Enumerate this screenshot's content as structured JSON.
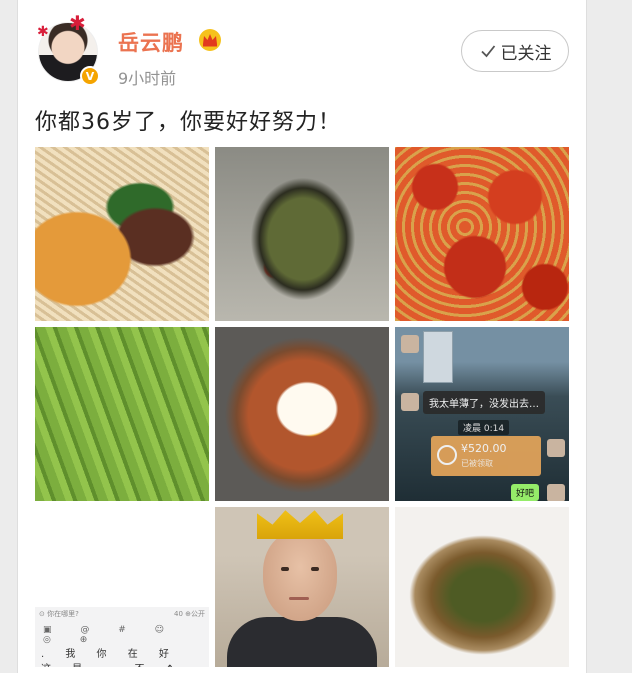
{
  "post": {
    "username": "岳云鹏",
    "timestamp": "9小时前",
    "follow_label": "已关注",
    "text": "你都36岁了，你要好好努力！",
    "verified_badge": "V",
    "colors": {
      "username": "#eb7350",
      "badge": "#f5a400",
      "crown": "#f0b400"
    }
  },
  "images": [
    {
      "name": "noodles-with-beef"
    },
    {
      "name": "century-egg-with-peppers"
    },
    {
      "name": "crayfish"
    },
    {
      "name": "edamame"
    },
    {
      "name": "fried-egg-rice-bowl"
    },
    {
      "name": "wechat-chat-screenshot",
      "chat": {
        "message": "我太单薄了，没发出去…",
        "time": "凌晨 0:14",
        "transfer_amount": "¥520.00",
        "transfer_note": "已被领取",
        "reply": "好吧"
      }
    },
    {
      "name": "keyboard-screenshot",
      "keyboard": {
        "hint": "⊙ 你在哪里?",
        "public_label": "40  ⊕公开",
        "icons": "▣ @ # ☺ ◎ ⊕",
        "candidates": ". 我 你 在 好 这 是 一 不 ↑ ⌄"
      }
    },
    {
      "name": "man-with-paper-crown"
    },
    {
      "name": "stir-fried-noodles"
    }
  ]
}
